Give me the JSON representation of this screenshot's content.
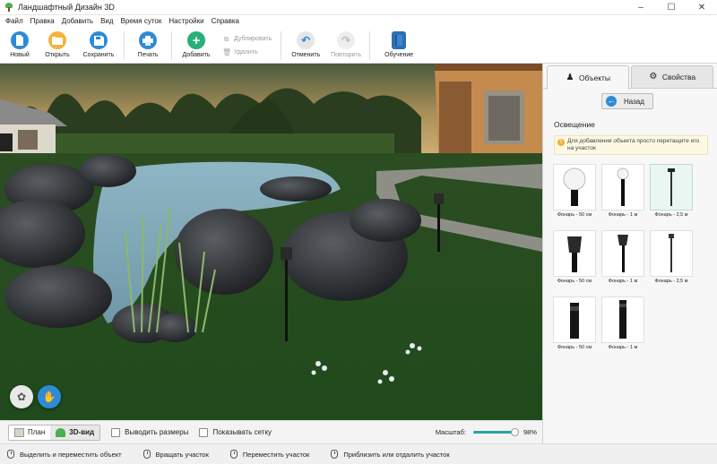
{
  "window": {
    "title": "Ландшафтный Дизайн 3D",
    "controls": [
      "–",
      "☐",
      "✕"
    ]
  },
  "menu": [
    "Файл",
    "Правка",
    "Добавить",
    "Вид",
    "Время суток",
    "Настройки",
    "Справка"
  ],
  "toolbar": {
    "new": "Новый",
    "open": "Открыть",
    "save": "Сохранить",
    "print": "Печать",
    "add": "Добавить",
    "duplicate": "Дублировать",
    "delete": "Удалить",
    "undo": "Отменить",
    "redo": "Повторить",
    "tutorial": "Обучение"
  },
  "bottombar": {
    "plan": "План",
    "view3d": "3D-вид",
    "show_sizes": "Выводить размеры",
    "show_grid": "Показывать сетку",
    "scale_label": "Масштаб:",
    "scale_value": "98%",
    "scale_fraction": 0.98
  },
  "status": [
    "Выделить и переместить объект",
    "Вращать участок",
    "Переместить участок",
    "Приблизить или отдалить участок"
  ],
  "panel": {
    "tab_objects": "Объекты",
    "tab_properties": "Свойства",
    "back": "Назад",
    "section": "Освещение",
    "tip": "Для добавления объекта просто перетащите его на участок",
    "items": [
      {
        "label": "Фонарь - 50 см",
        "style": "globe"
      },
      {
        "label": "Фонарь - 1 м",
        "style": "globe-post"
      },
      {
        "label": "Фонарь - 2,5 м",
        "style": "tall-pole",
        "selected": true
      },
      {
        "label": "Фонарь - 50 см",
        "style": "lantern"
      },
      {
        "label": "Фонарь - 1 м",
        "style": "lantern-post"
      },
      {
        "label": "Фонарь - 2,5 м",
        "style": "tall-thin"
      },
      {
        "label": "Фонарь - 50 см",
        "style": "bollard"
      },
      {
        "label": "Фонарь - 1 м",
        "style": "bollard-tall"
      }
    ]
  },
  "colors": {
    "accent_blue": "#2d8bd6",
    "folder": "#f3b33d",
    "add_green": "#26b07a",
    "slider": "#2aa3a3"
  }
}
